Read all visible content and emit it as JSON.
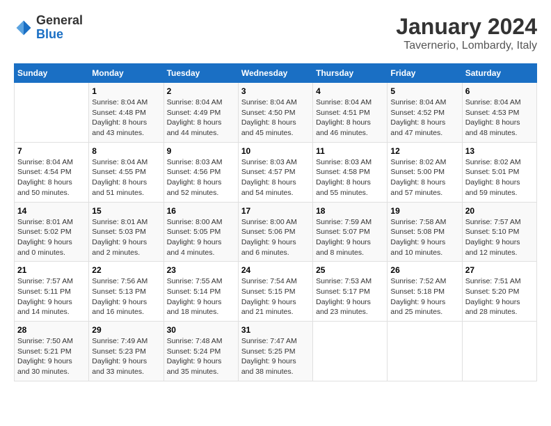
{
  "logo": {
    "general": "General",
    "blue": "Blue"
  },
  "header": {
    "title": "January 2024",
    "subtitle": "Tavernerio, Lombardy, Italy"
  },
  "weekdays": [
    "Sunday",
    "Monday",
    "Tuesday",
    "Wednesday",
    "Thursday",
    "Friday",
    "Saturday"
  ],
  "weeks": [
    [
      {
        "day": null
      },
      {
        "day": 1,
        "sunrise": "Sunrise: 8:04 AM",
        "sunset": "Sunset: 4:48 PM",
        "daylight": "Daylight: 8 hours and 43 minutes."
      },
      {
        "day": 2,
        "sunrise": "Sunrise: 8:04 AM",
        "sunset": "Sunset: 4:49 PM",
        "daylight": "Daylight: 8 hours and 44 minutes."
      },
      {
        "day": 3,
        "sunrise": "Sunrise: 8:04 AM",
        "sunset": "Sunset: 4:50 PM",
        "daylight": "Daylight: 8 hours and 45 minutes."
      },
      {
        "day": 4,
        "sunrise": "Sunrise: 8:04 AM",
        "sunset": "Sunset: 4:51 PM",
        "daylight": "Daylight: 8 hours and 46 minutes."
      },
      {
        "day": 5,
        "sunrise": "Sunrise: 8:04 AM",
        "sunset": "Sunset: 4:52 PM",
        "daylight": "Daylight: 8 hours and 47 minutes."
      },
      {
        "day": 6,
        "sunrise": "Sunrise: 8:04 AM",
        "sunset": "Sunset: 4:53 PM",
        "daylight": "Daylight: 8 hours and 48 minutes."
      }
    ],
    [
      {
        "day": 7,
        "sunrise": "Sunrise: 8:04 AM",
        "sunset": "Sunset: 4:54 PM",
        "daylight": "Daylight: 8 hours and 50 minutes."
      },
      {
        "day": 8,
        "sunrise": "Sunrise: 8:04 AM",
        "sunset": "Sunset: 4:55 PM",
        "daylight": "Daylight: 8 hours and 51 minutes."
      },
      {
        "day": 9,
        "sunrise": "Sunrise: 8:03 AM",
        "sunset": "Sunset: 4:56 PM",
        "daylight": "Daylight: 8 hours and 52 minutes."
      },
      {
        "day": 10,
        "sunrise": "Sunrise: 8:03 AM",
        "sunset": "Sunset: 4:57 PM",
        "daylight": "Daylight: 8 hours and 54 minutes."
      },
      {
        "day": 11,
        "sunrise": "Sunrise: 8:03 AM",
        "sunset": "Sunset: 4:58 PM",
        "daylight": "Daylight: 8 hours and 55 minutes."
      },
      {
        "day": 12,
        "sunrise": "Sunrise: 8:02 AM",
        "sunset": "Sunset: 5:00 PM",
        "daylight": "Daylight: 8 hours and 57 minutes."
      },
      {
        "day": 13,
        "sunrise": "Sunrise: 8:02 AM",
        "sunset": "Sunset: 5:01 PM",
        "daylight": "Daylight: 8 hours and 59 minutes."
      }
    ],
    [
      {
        "day": 14,
        "sunrise": "Sunrise: 8:01 AM",
        "sunset": "Sunset: 5:02 PM",
        "daylight": "Daylight: 9 hours and 0 minutes."
      },
      {
        "day": 15,
        "sunrise": "Sunrise: 8:01 AM",
        "sunset": "Sunset: 5:03 PM",
        "daylight": "Daylight: 9 hours and 2 minutes."
      },
      {
        "day": 16,
        "sunrise": "Sunrise: 8:00 AM",
        "sunset": "Sunset: 5:05 PM",
        "daylight": "Daylight: 9 hours and 4 minutes."
      },
      {
        "day": 17,
        "sunrise": "Sunrise: 8:00 AM",
        "sunset": "Sunset: 5:06 PM",
        "daylight": "Daylight: 9 hours and 6 minutes."
      },
      {
        "day": 18,
        "sunrise": "Sunrise: 7:59 AM",
        "sunset": "Sunset: 5:07 PM",
        "daylight": "Daylight: 9 hours and 8 minutes."
      },
      {
        "day": 19,
        "sunrise": "Sunrise: 7:58 AM",
        "sunset": "Sunset: 5:08 PM",
        "daylight": "Daylight: 9 hours and 10 minutes."
      },
      {
        "day": 20,
        "sunrise": "Sunrise: 7:57 AM",
        "sunset": "Sunset: 5:10 PM",
        "daylight": "Daylight: 9 hours and 12 minutes."
      }
    ],
    [
      {
        "day": 21,
        "sunrise": "Sunrise: 7:57 AM",
        "sunset": "Sunset: 5:11 PM",
        "daylight": "Daylight: 9 hours and 14 minutes."
      },
      {
        "day": 22,
        "sunrise": "Sunrise: 7:56 AM",
        "sunset": "Sunset: 5:13 PM",
        "daylight": "Daylight: 9 hours and 16 minutes."
      },
      {
        "day": 23,
        "sunrise": "Sunrise: 7:55 AM",
        "sunset": "Sunset: 5:14 PM",
        "daylight": "Daylight: 9 hours and 18 minutes."
      },
      {
        "day": 24,
        "sunrise": "Sunrise: 7:54 AM",
        "sunset": "Sunset: 5:15 PM",
        "daylight": "Daylight: 9 hours and 21 minutes."
      },
      {
        "day": 25,
        "sunrise": "Sunrise: 7:53 AM",
        "sunset": "Sunset: 5:17 PM",
        "daylight": "Daylight: 9 hours and 23 minutes."
      },
      {
        "day": 26,
        "sunrise": "Sunrise: 7:52 AM",
        "sunset": "Sunset: 5:18 PM",
        "daylight": "Daylight: 9 hours and 25 minutes."
      },
      {
        "day": 27,
        "sunrise": "Sunrise: 7:51 AM",
        "sunset": "Sunset: 5:20 PM",
        "daylight": "Daylight: 9 hours and 28 minutes."
      }
    ],
    [
      {
        "day": 28,
        "sunrise": "Sunrise: 7:50 AM",
        "sunset": "Sunset: 5:21 PM",
        "daylight": "Daylight: 9 hours and 30 minutes."
      },
      {
        "day": 29,
        "sunrise": "Sunrise: 7:49 AM",
        "sunset": "Sunset: 5:23 PM",
        "daylight": "Daylight: 9 hours and 33 minutes."
      },
      {
        "day": 30,
        "sunrise": "Sunrise: 7:48 AM",
        "sunset": "Sunset: 5:24 PM",
        "daylight": "Daylight: 9 hours and 35 minutes."
      },
      {
        "day": 31,
        "sunrise": "Sunrise: 7:47 AM",
        "sunset": "Sunset: 5:25 PM",
        "daylight": "Daylight: 9 hours and 38 minutes."
      },
      {
        "day": null
      },
      {
        "day": null
      },
      {
        "day": null
      }
    ]
  ]
}
